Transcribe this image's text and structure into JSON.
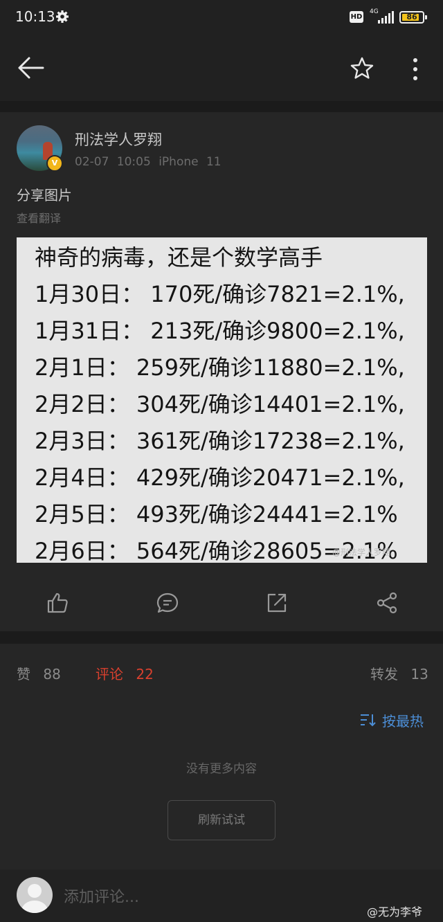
{
  "status_bar": {
    "time": "10:13",
    "hd": "HD",
    "network": "4G",
    "battery": "86",
    "battery_level": 0.86
  },
  "nav": {
    "back_icon": "arrow-left-icon",
    "favorite_icon": "star-icon",
    "more_icon": "more-vertical-icon"
  },
  "post": {
    "author": "刑法学人罗翔",
    "badge": "V",
    "timestamp": "02-07 10:05",
    "device": "iPhone 11",
    "text": "分享图片",
    "translate_link": "查看翻译",
    "image": {
      "title": "神奇的病毒，还是个数学高手",
      "lines": [
        "1月30日： 170死/确诊7821=2.1%,",
        "1月31日： 213死/确诊9800=2.1%,",
        "2月1日： 259死/确诊11880=2.1%,",
        "2月2日： 304死/确诊14401=2.1%,",
        "2月3日： 361死/确诊17238=2.1%,",
        "2月4日： 429死/确诊20471=2.1%,",
        "2月5日： 493死/确诊24441=2.1%",
        "2月6日： 564死/确诊28605=2.1%"
      ],
      "watermark": "@刑法学人罗翔"
    },
    "actions": [
      "thumbs-up-icon",
      "comment-icon",
      "share-out-icon",
      "share-network-icon"
    ]
  },
  "stats": {
    "likes_label": "赞",
    "likes_count": "88",
    "comments_label": "评论",
    "comments_count": "22",
    "reposts_label": "转发",
    "reposts_count": "13"
  },
  "comments": {
    "sort_label": "按最热",
    "empty_text": "没有更多内容",
    "refresh_button": "刷新试试",
    "input_placeholder": "添加评论..."
  },
  "credit": "@无为李爷",
  "colors": {
    "background": "#262626",
    "accent_red": "#d9402e",
    "accent_blue": "#4c8ed6",
    "badge_gold": "#f2b61a"
  }
}
